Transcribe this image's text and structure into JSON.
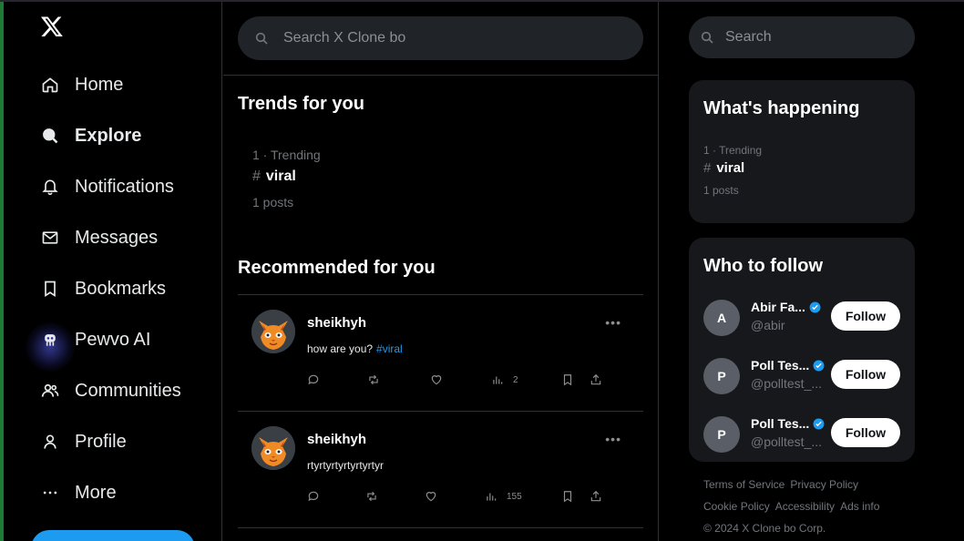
{
  "app": {
    "logo": "X"
  },
  "sidebar": {
    "items": [
      {
        "label": "Home",
        "icon": "home-icon",
        "active": false
      },
      {
        "label": "Explore",
        "icon": "search-icon",
        "active": true
      },
      {
        "label": "Notifications",
        "icon": "bell-icon",
        "active": false
      },
      {
        "label": "Messages",
        "icon": "envelope-icon",
        "active": false
      },
      {
        "label": "Bookmarks",
        "icon": "bookmark-icon",
        "active": false
      },
      {
        "label": "Pewvo AI",
        "icon": "ai-bot-icon",
        "active": false
      },
      {
        "label": "Communities",
        "icon": "people-icon",
        "active": false
      },
      {
        "label": "Profile",
        "icon": "user-icon",
        "active": false
      },
      {
        "label": "More",
        "icon": "ellipsis-icon",
        "active": false
      }
    ]
  },
  "main": {
    "search_placeholder": "Search X Clone bo",
    "trends_title": "Trends for you",
    "trend": {
      "meta": "1 · Trending",
      "hash": "#",
      "tag": "viral",
      "posts": "1 posts"
    },
    "recommended_title": "Recommended for you",
    "posts": [
      {
        "author": "sheikhyh",
        "text": "how are you?",
        "hashtag": "#viral",
        "views": "2"
      },
      {
        "author": "sheikhyh",
        "text": "rtyrtyrtyrtyrtyrtyr",
        "hashtag": "",
        "views": "155"
      }
    ]
  },
  "right": {
    "search_placeholder": "Search",
    "whats_happening": {
      "title": "What's happening",
      "meta": "1 · Trending",
      "hash": "#",
      "tag": "viral",
      "posts": "1 posts"
    },
    "who_to_follow": {
      "title": "Who to follow",
      "follow_label": "Follow",
      "users": [
        {
          "initial": "A",
          "name": "Abir Fa...",
          "handle": "@abir"
        },
        {
          "initial": "P",
          "name": "Poll Tes...",
          "handle": "@polltest_..."
        },
        {
          "initial": "P",
          "name": "Poll Tes...",
          "handle": "@polltest_..."
        }
      ]
    },
    "footer": {
      "row1": [
        "Terms of Service",
        "Privacy Policy"
      ],
      "row2": [
        "Cookie Policy",
        "Accessibility",
        "Ads info"
      ],
      "copyright": "© 2024 X Clone bo Corp."
    }
  },
  "colors": {
    "accent": "#1d9bf0",
    "background": "#000000",
    "card": "#16181c",
    "muted": "#71767b"
  }
}
